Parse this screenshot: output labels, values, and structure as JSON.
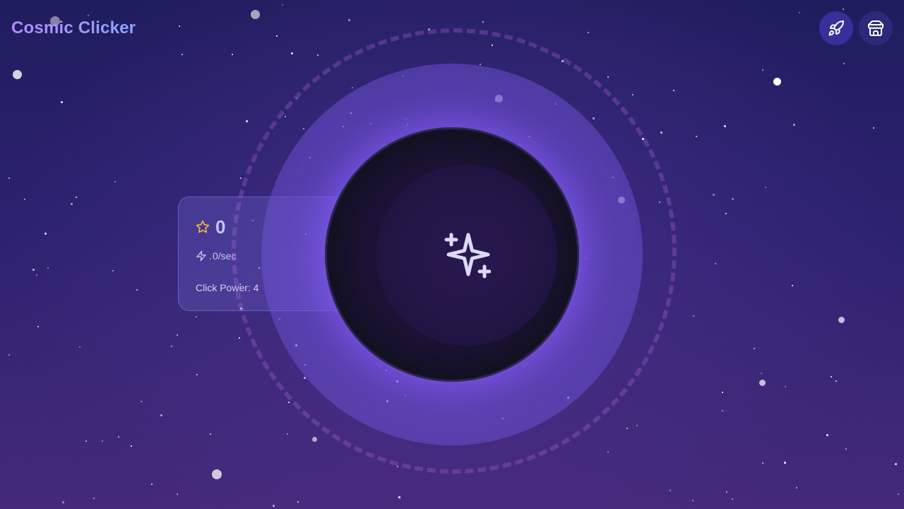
{
  "app": {
    "title": "Cosmic Clicker"
  },
  "header": {
    "buttons": [
      {
        "name": "rocket-button",
        "icon": "rocket-icon"
      },
      {
        "name": "shop-button",
        "icon": "store-icon"
      }
    ]
  },
  "stats": {
    "score": "0",
    "score_icon": "star-icon",
    "rate": "0/sec",
    "rate_icon": "lightning-icon",
    "click_power": "Click Power: 4"
  },
  "clicker": {
    "icon": "sparkles-icon"
  },
  "colors": {
    "accent_purple": "#8b5cf6",
    "title_gradient_start": "#b48bff",
    "title_gradient_end": "#8fa4ff",
    "star_yellow": "#f5b83a",
    "rocket_button_bg": "#38309a",
    "shop_button_bg": "#2c2a78"
  }
}
